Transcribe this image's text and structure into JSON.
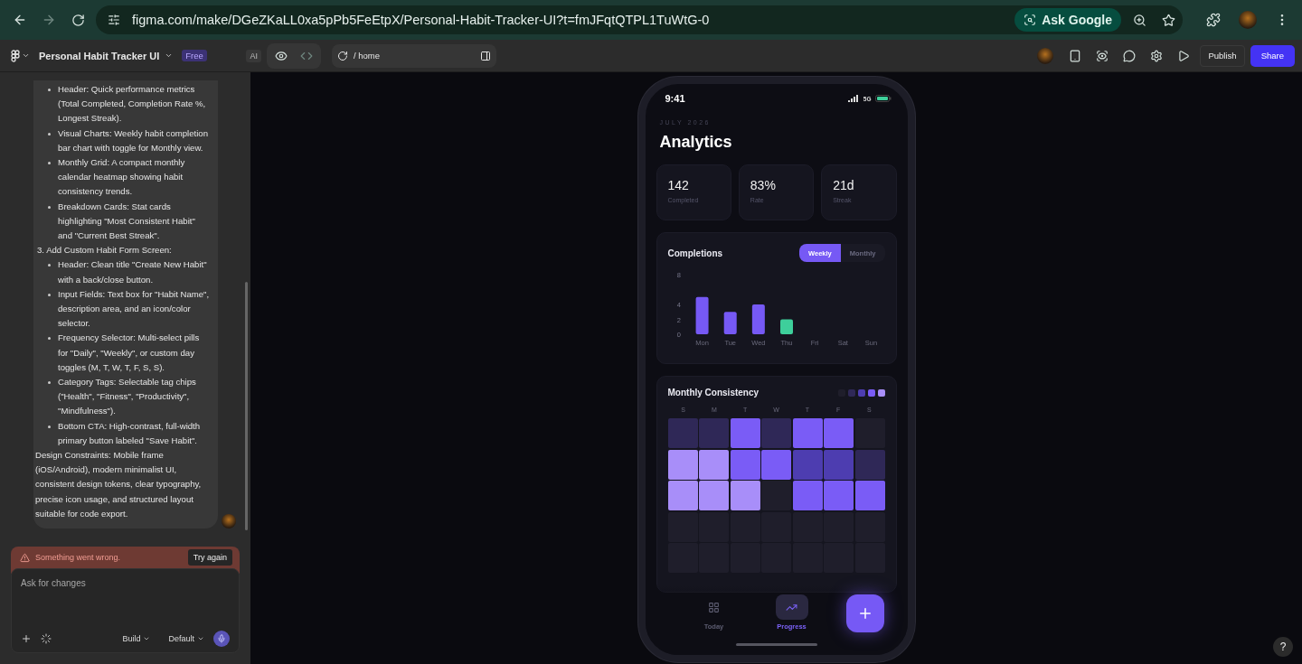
{
  "browser": {
    "url": "figma.com/make/DGeZKaLL0xa5pPb5FeEtpX/Personal-Habit-Tracker-UI?t=fmJFqtQTPL1TuWtG-0",
    "ask_button": "Ask Google"
  },
  "toolbar": {
    "project": "Personal Habit Tracker UI",
    "plan_badge": "Free",
    "ai_label": "AI",
    "path": "/ home",
    "publish": "Publish",
    "share": "Share"
  },
  "chat": {
    "lines": [
      {
        "kind": "bullet",
        "text": "Header: Quick performance metrics (Total Completed, Completion Rate %, Longest Streak)."
      },
      {
        "kind": "bullet",
        "text": "Visual Charts: Weekly habit completion bar chart with toggle for Monthly view."
      },
      {
        "kind": "bullet",
        "text": "Monthly Grid: A compact monthly calendar heatmap showing habit consistency trends."
      },
      {
        "kind": "bullet",
        "text": "Breakdown Cards: Stat cards highlighting \"Most Consistent Habit\" and \"Current Best Streak\"."
      },
      {
        "kind": "heading",
        "text": "3. Add Custom Habit Form Screen:"
      },
      {
        "kind": "bullet",
        "text": "Header: Clean title \"Create New Habit\" with a back/close button."
      },
      {
        "kind": "bullet",
        "text": "Input Fields: Text box for \"Habit Name\", description area, and an icon/color selector."
      },
      {
        "kind": "bullet",
        "text": "Frequency Selector: Multi-select pills for \"Daily\", \"Weekly\", or custom day toggles (M, T, W, T, F, S, S)."
      },
      {
        "kind": "bullet",
        "text": "Category Tags: Selectable tag chips (\"Health\", \"Fitness\", \"Productivity\", \"Mindfulness\")."
      },
      {
        "kind": "bullet",
        "text": "Bottom CTA: High-contrast, full-width primary button labeled \"Save Habit\"."
      },
      {
        "kind": "paragraph",
        "text": "Design Constraints: Mobile frame (iOS/Android), modern minimalist UI, consistent design tokens, clear typography, precise icon usage, and structured layout suitable for code export."
      }
    ],
    "error": {
      "message": "Something went wrong.",
      "retry": "Try again"
    },
    "input": {
      "placeholder": "Ask for changes"
    },
    "mode": "Build",
    "model": "Default"
  },
  "phone": {
    "time": "9:41",
    "network": "5G",
    "month": "JULY 2026",
    "title": "Analytics",
    "stats": [
      {
        "value": "142",
        "label": "Completed"
      },
      {
        "value": "83%",
        "label": "Rate"
      },
      {
        "value": "21d",
        "label": "Streak"
      }
    ],
    "completions": {
      "title": "Completions",
      "toggle": [
        {
          "label": "Weekly",
          "selected": true
        },
        {
          "label": "Monthly",
          "selected": false
        }
      ],
      "chart_data": {
        "type": "bar",
        "stacked": true,
        "categories": [
          "Mon",
          "Tue",
          "Wed",
          "Thu",
          "Fri",
          "Sat",
          "Sun"
        ],
        "yticks": [
          0,
          2,
          4,
          8
        ],
        "ylim": [
          0,
          8
        ],
        "series": [
          {
            "color": "#7659f5",
            "values": [
              5,
              3,
              4,
              null,
              null,
              null,
              null
            ]
          },
          {
            "color": "#3ecf9b",
            "values": [
              null,
              null,
              null,
              2,
              null,
              null,
              null
            ]
          }
        ]
      }
    },
    "consistency": {
      "title": "Monthly Consistency",
      "legend": [
        {
          "color": "#1f1e2b"
        },
        {
          "color": "#2f2857"
        },
        {
          "color": "#4d3db0"
        },
        {
          "color": "#7a5cf6"
        },
        {
          "color": "#a88ef9"
        }
      ],
      "weekdays": [
        "S",
        "M",
        "T",
        "W",
        "T",
        "F",
        "S"
      ],
      "rows": [
        {
          "cells": [
            {
              "color": "#2f2857"
            },
            {
              "color": "#2f2857"
            },
            {
              "color": "#7a5cf6"
            },
            {
              "color": "#2f2857"
            },
            {
              "color": "#7a5cf6"
            },
            {
              "color": "#7a5cf6"
            },
            {
              "color": "#1f1e2b"
            }
          ]
        },
        {
          "cells": [
            {
              "color": "#a88ef9"
            },
            {
              "color": "#a88ef9"
            },
            {
              "color": "#7a5cf6"
            },
            {
              "color": "#7a5cf6"
            },
            {
              "color": "#4d3db0"
            },
            {
              "color": "#4d3db0"
            },
            {
              "color": "#2f2857"
            }
          ]
        },
        {
          "cells": [
            {
              "color": "#a88ef9"
            },
            {
              "color": "#a88ef9"
            },
            {
              "color": "#a88ef9"
            },
            {
              "color": "#1f1e2b"
            },
            {
              "color": "#7a5cf6"
            },
            {
              "color": "#7a5cf6"
            },
            {
              "color": "#7a5cf6"
            }
          ]
        },
        {
          "cells": [
            {
              "color": "#1f1e2b"
            },
            {
              "color": "#1f1e2b"
            },
            {
              "color": "#1f1e2b"
            },
            {
              "color": "#1f1e2b"
            },
            {
              "color": "#1f1e2b"
            },
            {
              "color": "#1f1e2b"
            },
            {
              "color": "#1f1e2b"
            }
          ]
        },
        {
          "cells": [
            {
              "color": "#1f1e2b"
            },
            {
              "color": "#1f1e2b"
            },
            {
              "color": "#1f1e2b"
            },
            {
              "color": "#1f1e2b"
            },
            {
              "color": "#1f1e2b"
            },
            {
              "color": "#1f1e2b"
            },
            {
              "color": "#1f1e2b"
            }
          ]
        }
      ]
    },
    "nav": [
      {
        "kind": "today",
        "label": "Today",
        "selected": false
      },
      {
        "kind": "progress",
        "label": "Progress",
        "selected": true
      }
    ]
  },
  "help": "?"
}
